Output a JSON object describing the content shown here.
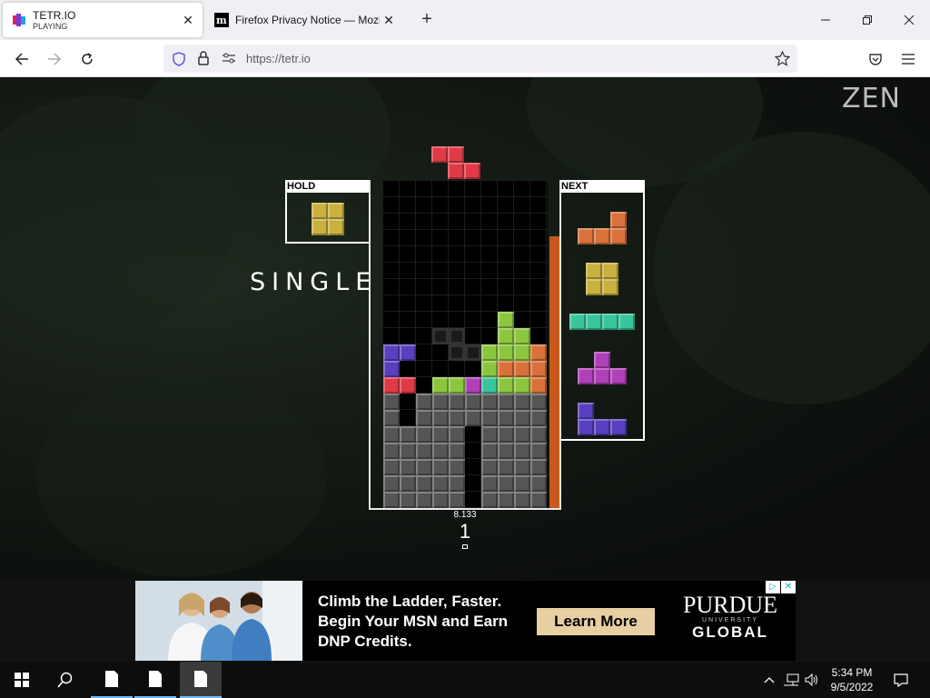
{
  "browser": {
    "tabs": [
      {
        "title": "TETR.IO",
        "subtitle": "PLAYING"
      },
      {
        "title": "Firefox Privacy Notice — Mozilla"
      }
    ],
    "url": "https://tetr.io"
  },
  "game": {
    "mode_label": "ZEN",
    "hold_label": "HOLD",
    "next_label": "NEXT",
    "clear_text": "SINGLE",
    "stat_small": "8.133",
    "stat_big": "1",
    "colors": {
      "Z": "#e03a48",
      "O": "#c9b040",
      "L": "#d9713a",
      "I": "#3ac49b",
      "T": "#b040b8",
      "J": "#5840c0",
      "S": "#8cc63f",
      "G": "#555555",
      "ghost": "#2a2a2a"
    },
    "hold_piece": "O",
    "next_queue": [
      "L",
      "O",
      "I",
      "T",
      "J"
    ],
    "board_rows": [
      "..........",
      "..........",
      "..........",
      "..........",
      "..........",
      "..........",
      "..........",
      "..........",
      ".......S..",
      "...gg..SS.",
      "JJ..ggSSSL",
      "J.....SLLL",
      "ZZ.SSTISSL",
      "G.GGGGGGGG",
      "G.GGGGGGGG",
      "GGGGG.GGGG",
      "GGGGG.GGGG",
      "GGGGG.GGGG",
      "GGGGG.GGGG",
      "GGGGG.GGGG"
    ],
    "active_piece": "Z"
  },
  "ad": {
    "headline": "Climb the Ladder, Faster. Begin Your MSN and Earn DNP Credits.",
    "cta": "Learn More",
    "brand_line1": "PURDUE",
    "brand_line2": "UNIVERSITY",
    "brand_line3": "GLOBAL"
  },
  "taskbar": {
    "time": "5:34 PM",
    "date": "9/5/2022"
  }
}
